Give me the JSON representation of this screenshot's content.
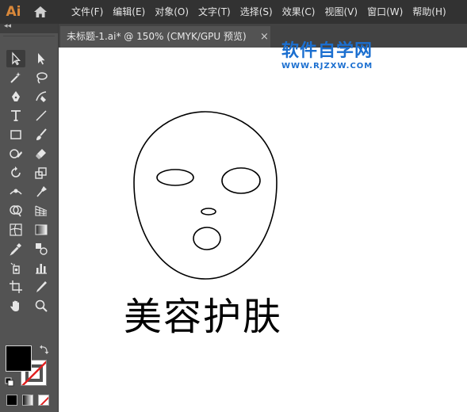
{
  "app": {
    "logo_text": "Ai",
    "logo_color": "#d9883a"
  },
  "menu": {
    "items": [
      {
        "label": "文件(F)"
      },
      {
        "label": "编辑(E)"
      },
      {
        "label": "对象(O)"
      },
      {
        "label": "文字(T)"
      },
      {
        "label": "选择(S)"
      },
      {
        "label": "效果(C)"
      },
      {
        "label": "视图(V)"
      },
      {
        "label": "窗口(W)"
      },
      {
        "label": "帮助(H)"
      }
    ]
  },
  "document_tab": {
    "title": "未标题-1.ai* @ 150% (CMYK/GPU 预览)",
    "close_symbol": "×"
  },
  "toolbar": {
    "collapse_symbol": "◂◂",
    "tools": [
      {
        "name": "selection-tool",
        "icon": "selection-arrow-icon"
      },
      {
        "name": "direct-selection-tool",
        "icon": "direct-selection-icon"
      },
      {
        "name": "magic-wand-tool",
        "icon": "magic-wand-icon"
      },
      {
        "name": "lasso-tool",
        "icon": "lasso-icon"
      },
      {
        "name": "pen-tool",
        "icon": "pen-icon"
      },
      {
        "name": "curvature-tool",
        "icon": "curvature-icon"
      },
      {
        "name": "type-tool",
        "icon": "type-icon"
      },
      {
        "name": "line-tool",
        "icon": "line-icon"
      },
      {
        "name": "rectangle-tool",
        "icon": "rectangle-icon"
      },
      {
        "name": "paintbrush-tool",
        "icon": "paintbrush-icon"
      },
      {
        "name": "shaper-tool",
        "icon": "shaper-icon"
      },
      {
        "name": "eraser-tool",
        "icon": "eraser-icon"
      },
      {
        "name": "rotate-tool",
        "icon": "rotate-icon"
      },
      {
        "name": "scale-tool",
        "icon": "scale-icon"
      },
      {
        "name": "width-tool",
        "icon": "width-icon"
      },
      {
        "name": "puppet-warp-tool",
        "icon": "puppet-warp-icon"
      },
      {
        "name": "shape-builder-tool",
        "icon": "shape-builder-icon"
      },
      {
        "name": "perspective-grid-tool",
        "icon": "perspective-grid-icon"
      },
      {
        "name": "mesh-tool",
        "icon": "mesh-icon"
      },
      {
        "name": "gradient-tool",
        "icon": "gradient-icon"
      },
      {
        "name": "eyedropper-tool",
        "icon": "eyedropper-icon"
      },
      {
        "name": "blend-tool",
        "icon": "blend-icon"
      },
      {
        "name": "symbol-sprayer-tool",
        "icon": "symbol-sprayer-icon"
      },
      {
        "name": "column-graph-tool",
        "icon": "column-graph-icon"
      },
      {
        "name": "artboard-tool",
        "icon": "artboard-icon"
      },
      {
        "name": "slice-tool",
        "icon": "slice-icon"
      },
      {
        "name": "hand-tool",
        "icon": "hand-icon"
      },
      {
        "name": "zoom-tool",
        "icon": "zoom-icon"
      }
    ],
    "fill_color": "#000000",
    "stroke_color": "none"
  },
  "canvas": {
    "artwork_text": "美容护肤",
    "background": "#ffffff"
  },
  "watermark": {
    "title": "软件自学网",
    "url": "WWW.RJZXW.COM",
    "color": "#1b6fd0"
  }
}
